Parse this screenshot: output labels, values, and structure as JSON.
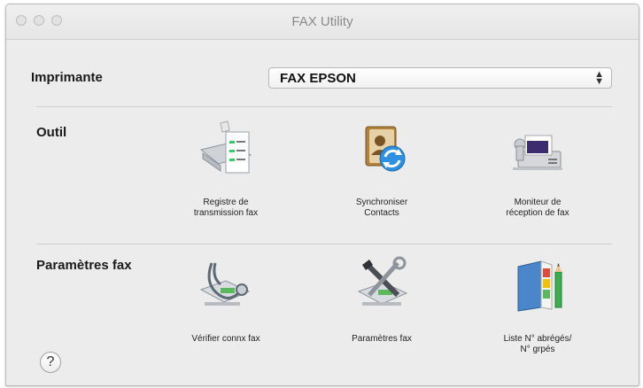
{
  "window": {
    "title": "FAX Utility"
  },
  "printer": {
    "label": "Imprimante",
    "selected": "FAX EPSON",
    "arrows_icon": "updown-arrows-icon"
  },
  "tools": {
    "label": "Outil",
    "items": [
      {
        "icon": "transmission-log-icon",
        "label": "Registre de\ntransmission fax"
      },
      {
        "icon": "sync-contacts-icon",
        "label": "Synchroniser\nContacts"
      },
      {
        "icon": "fax-monitor-icon",
        "label": "Moniteur de\nréception de fax"
      }
    ]
  },
  "fax_settings": {
    "label": "Paramètres fax",
    "items": [
      {
        "icon": "stethoscope-icon",
        "label": "Vérifier connx fax"
      },
      {
        "icon": "tools-settings-icon",
        "label": "Paramètres fax"
      },
      {
        "icon": "address-book-icon",
        "label": "Liste N° abrégés/\nN° grpés"
      }
    ]
  },
  "help": {
    "label": "?"
  }
}
